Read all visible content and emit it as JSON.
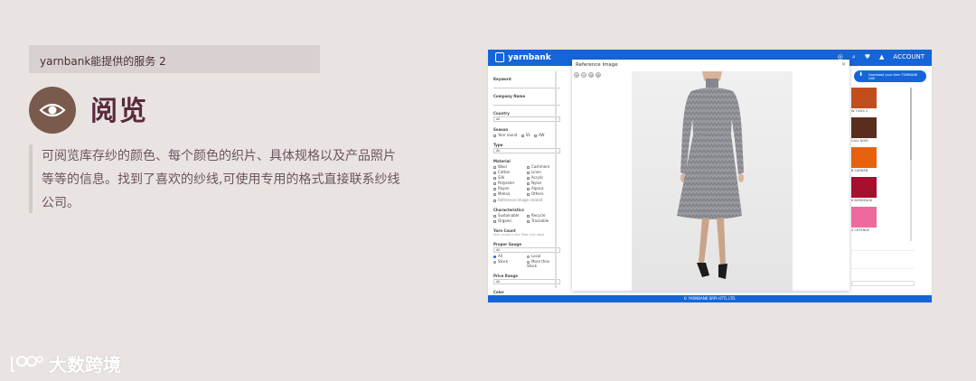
{
  "slide": {
    "tag": "yarnbank能提供的服务 2",
    "title": "阅览",
    "description": "可阅览库存纱的颜色、每个颜色的织片、具体规格以及产品照片等等的信息。找到了喜欢的纱线,可使用专用的格式直接联系纱线公司。",
    "watermark": "大数跨境",
    "icon": "eye-icon",
    "colors": {
      "title": "#5a2a3c",
      "icon_bg": "#7a5a4d",
      "tag_bg": "#d9d1cf",
      "background": "#e9e4e1"
    }
  },
  "app": {
    "brand": "yarnbank",
    "nav_account": "ACCOUNT",
    "footer": "© YARNBANK SRPI HTTL LTD.",
    "accent": "#1565d8",
    "cta_text": "Download your item TOMBANK LAB",
    "filters": {
      "keyword": "Keyword",
      "company": "Company Name",
      "country": "Country",
      "country_value": "All",
      "season": "Season",
      "seasons": [
        "Year round",
        "SS",
        "AW"
      ],
      "type": "Type",
      "type_value": "All",
      "material": "Material",
      "materials": [
        "Wool",
        "Cashmere",
        "Cotton",
        "Linen",
        "Silk",
        "Acrylic",
        "Polyester",
        "Nylon",
        "Rayon",
        "Alpaca",
        "Mohair",
        "Others"
      ],
      "reference": "Reference Image related",
      "characteristics": "Characteristics",
      "characteristic_items": [
        "Sustainable",
        "Recycle",
        "Organic",
        "Traceable"
      ],
      "yarn_count": "Yarn Count",
      "yarn_count_hint": "Yarn count in the filter unit label",
      "proper_gauge": "Proper Gauge",
      "proper_gauge_value": "All",
      "stock_options": [
        "All",
        "Local",
        "Stock",
        "More than Stock"
      ],
      "price_range": "Price Range",
      "price_value": "All",
      "color": "Color",
      "swatch_colors": [
        "#d62b2b",
        "#e87a2e",
        "#e8c42e",
        "#2eae4e",
        "#2e6ee8",
        "#7a2ee8",
        "#e82ea6",
        "#8a5a2e",
        "#222222",
        "#777777",
        "#ffffff",
        "#c48a5a",
        "#a8d8f0",
        "#f0d0e0",
        "#c0c0c0",
        "#e8e090"
      ]
    },
    "results": [
      {
        "label": "W TICKS 1",
        "color": "#c24e1e"
      },
      {
        "label": "CALL NOIR",
        "color": "#5a2e1e"
      },
      {
        "label": "B CARDEN",
        "color": "#e8620e"
      },
      {
        "label": "K BORDEAUX",
        "color": "#a80e2e"
      },
      {
        "label": "S CHTENGE",
        "color": "#ee6a9e"
      }
    ],
    "modal": {
      "title": "Reference Image",
      "close": "×",
      "tools": [
        "+",
        "−",
        "⟲",
        "⟳"
      ]
    }
  }
}
